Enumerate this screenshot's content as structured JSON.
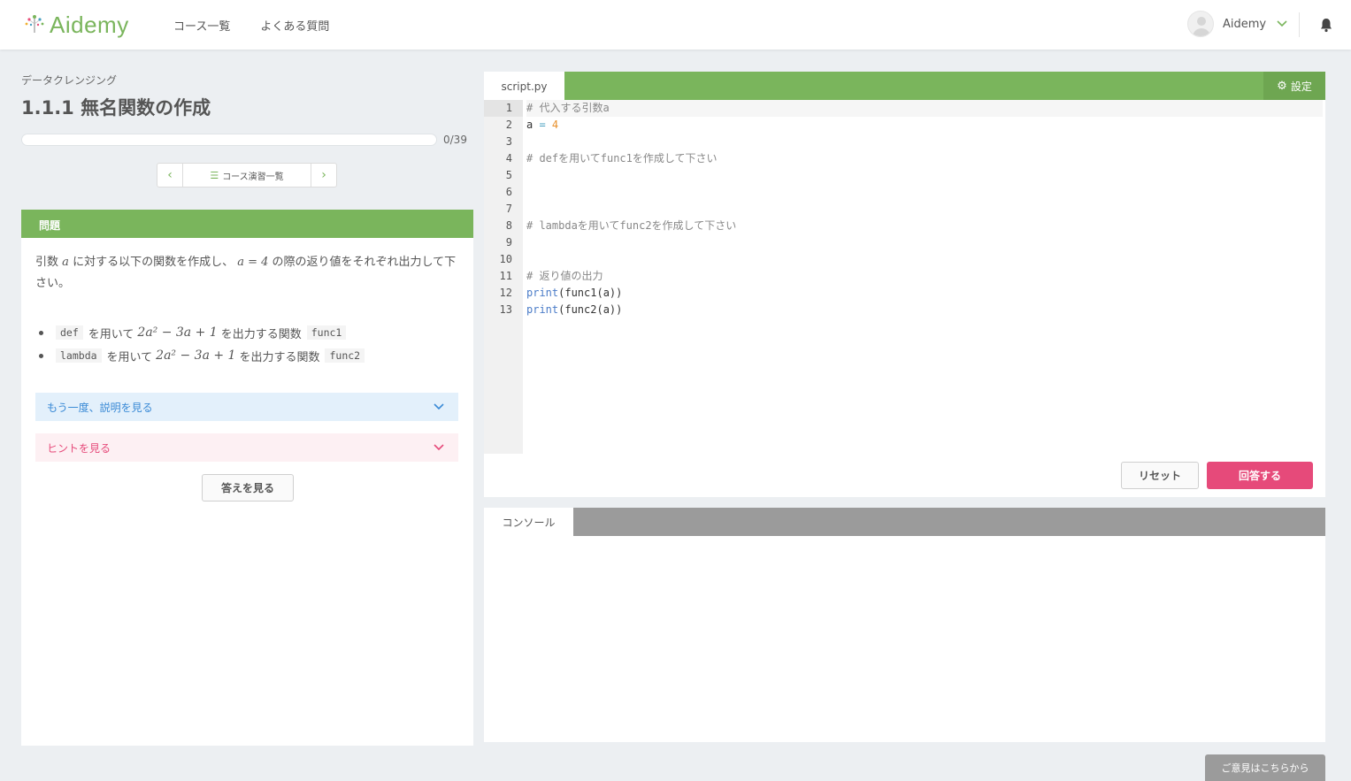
{
  "header": {
    "logo_text": "Aidemy",
    "nav": [
      "コース一覧",
      "よくある質問"
    ],
    "user_name": "Aidemy"
  },
  "lesson": {
    "category": "データクレンジング",
    "title": "1.1.1 無名関数の作成",
    "progress": {
      "current": 0,
      "total": 39,
      "label": "0/39"
    },
    "pager_label": "コース演習一覧"
  },
  "problem": {
    "heading": "問題",
    "text_part1": "引数",
    "var_a": "a",
    "text_part2": "に対する以下の関数を作成し、",
    "eq": "a = 4",
    "text_part3": "の際の返り値をそれぞれ出力して下さい。",
    "bullets": [
      {
        "code": "def",
        "mid": "を用いて",
        "math": "2a² − 3a + 1",
        "tail": "を出力する関数",
        "fn": "func1"
      },
      {
        "code": "lambda",
        "mid": "を用いて",
        "math": "2a² − 3a + 1",
        "tail": "を出力する関数",
        "fn": "func2"
      }
    ],
    "explain_label": "もう一度、説明を見る",
    "hint_label": "ヒントを見る",
    "answer_label": "答えを見る"
  },
  "editor": {
    "tab": "script.py",
    "settings_label": "設定",
    "line_numbers": [
      "1",
      "2",
      "3",
      "4",
      "5",
      "6",
      "7",
      "8",
      "9",
      "10",
      "11",
      "12",
      "13"
    ],
    "lines": {
      "l1": "# 代入する引数a",
      "l2_var": "a",
      "l2_op": " = ",
      "l2_num": "4",
      "l4": "# defを用いてfunc1を作成して下さい",
      "l8": "# lambdaを用いてfunc2を作成して下さい",
      "l11": "# 返り値の出力",
      "l12_fn": "print",
      "l12_rest": "(func1(a))",
      "l13_fn": "print",
      "l13_rest": "(func2(a))"
    },
    "reset_label": "リセット",
    "submit_label": "回答する"
  },
  "console": {
    "tab": "コンソール"
  },
  "feedback_label": "ご意見はこちらから",
  "colors": {
    "brand_green": "#7ab55c",
    "accent_pink": "#e64a7a",
    "info_blue": "#3a8ad6"
  }
}
